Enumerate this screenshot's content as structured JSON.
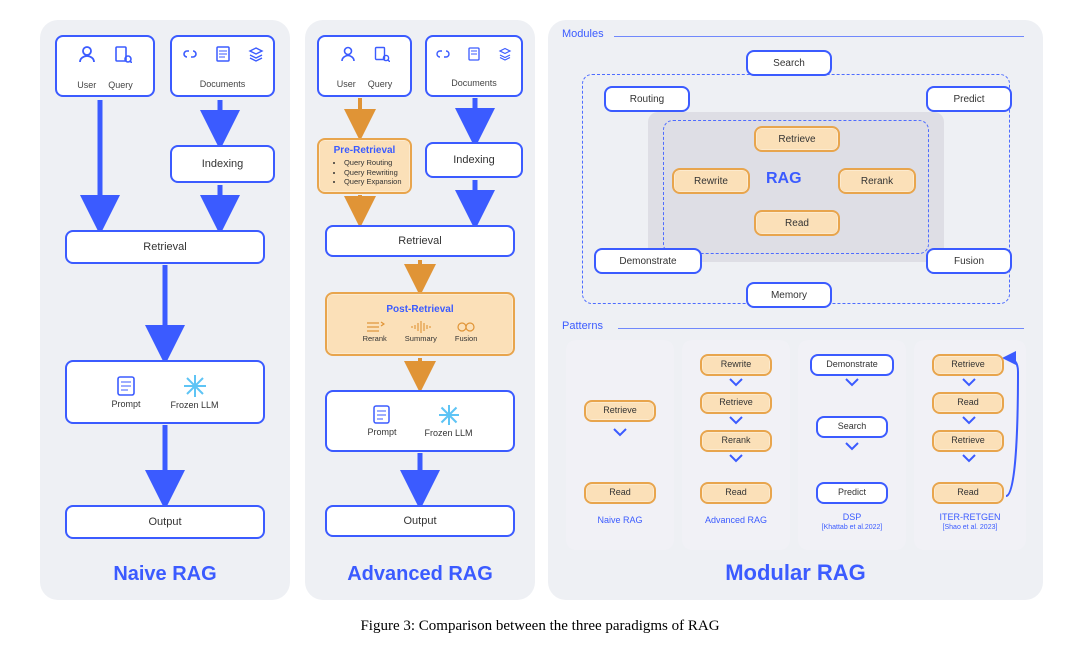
{
  "caption": "Figure 3: Comparison between the three paradigms of RAG",
  "titles": {
    "naive": "Naive RAG",
    "advanced": "Advanced RAG",
    "modular": "Modular RAG"
  },
  "top": {
    "user": "User",
    "query": "Query",
    "documents": "Documents"
  },
  "nodes": {
    "indexing": "Indexing",
    "retrieval": "Retrieval",
    "prompt": "Prompt",
    "frozen": "Frozen LLM",
    "output": "Output",
    "pre_hdr": "Pre-Retrieval",
    "pre_b1": "Query Routing",
    "pre_b2": "Query Rewriting",
    "pre_b3": "Query Expansion",
    "post_hdr": "Post-Retrieval",
    "post_sub1": "Rerank",
    "post_sub2": "Summary",
    "post_sub3": "Fusion"
  },
  "mod": {
    "sec_modules": "Modules",
    "sec_patterns": "Patterns",
    "search": "Search",
    "routing": "Routing",
    "predict": "Predict",
    "retrieve": "Retrieve",
    "rewrite": "Rewrite",
    "rag": "RAG",
    "rerank": "Rerank",
    "read": "Read",
    "demonstrate": "Demonstrate",
    "fusion": "Fusion",
    "memory": "Memory",
    "p1": "Retrieve",
    "p1b": "Read",
    "p2a": "Rewrite",
    "p2b": "Retrieve",
    "p2c": "Rerank",
    "p2d": "Read",
    "p3a": "Demonstrate",
    "p3b": "Search",
    "p3c": "Predict",
    "p4a": "Retrieve",
    "p4b": "Read",
    "p4c": "Retrieve",
    "p4d": "Read",
    "pl1": "Naive RAG",
    "pl2": "Advanced RAG",
    "pl3": "DSP",
    "pl3s": "[Khattab et al.2022]",
    "pl4": "ITER-RETGEN",
    "pl4s": "[Shao et al. 2023]"
  }
}
